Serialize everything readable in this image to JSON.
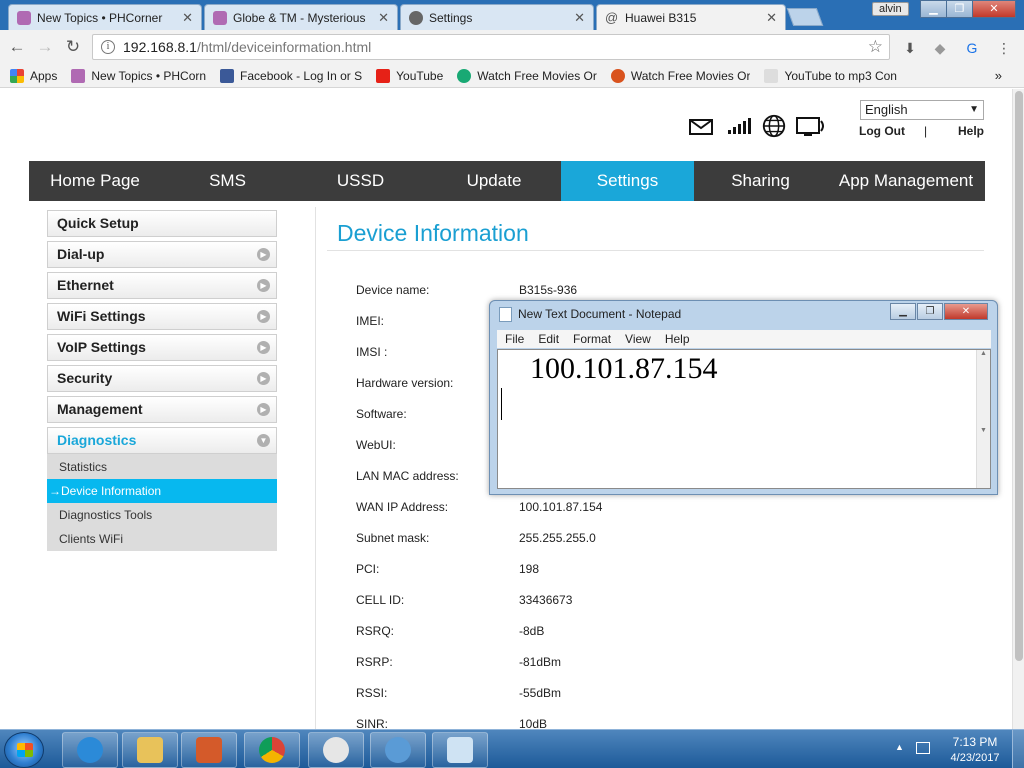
{
  "browser": {
    "tabs": [
      {
        "label": "New Topics • PHCorner",
        "active": false,
        "icon": "phcorner-favicon"
      },
      {
        "label": "Globe & TM - Mysterious",
        "active": false,
        "icon": "phcorner-favicon"
      },
      {
        "label": "Settings",
        "active": false,
        "icon": "gear-icon"
      },
      {
        "label": "Huawei B315",
        "active": true,
        "icon": "at-sign-icon"
      }
    ],
    "tab_close_glyph": "✕",
    "user": "alvin",
    "url_host": "192.168.8.1",
    "url_path": "/html/deviceinformation.html",
    "bookmarks": [
      {
        "label": "Apps",
        "icon": "apps-grid-icon"
      },
      {
        "label": "New Topics • PHCorn",
        "icon": "phcorner-favicon"
      },
      {
        "label": "Facebook - Log In or S",
        "icon": "facebook-icon"
      },
      {
        "label": "YouTube",
        "icon": "youtube-icon"
      },
      {
        "label": "Watch Free Movies Or",
        "icon": "play-icon"
      },
      {
        "label": "Watch Free Movies Or",
        "icon": "movie-icon"
      },
      {
        "label": "YouTube to mp3 Con",
        "icon": "yt-mp3-icon"
      }
    ],
    "bookmarks_more": "»"
  },
  "router": {
    "language": "English",
    "logout": "Log Out",
    "separator": "|",
    "help": "Help",
    "nav": [
      {
        "label": "Home Page",
        "active": false
      },
      {
        "label": "SMS",
        "active": false
      },
      {
        "label": "USSD",
        "active": false
      },
      {
        "label": "Update",
        "active": false
      },
      {
        "label": "Settings",
        "active": true
      },
      {
        "label": "Sharing",
        "active": false
      },
      {
        "label": "App Management",
        "active": false
      }
    ],
    "side_menu": [
      {
        "label": "Quick Setup",
        "expandable": false
      },
      {
        "label": "Dial-up",
        "expandable": true
      },
      {
        "label": "Ethernet",
        "expandable": true
      },
      {
        "label": "WiFi Settings",
        "expandable": true
      },
      {
        "label": "VoIP Settings",
        "expandable": true
      },
      {
        "label": "Security",
        "expandable": true
      },
      {
        "label": "Management",
        "expandable": true
      }
    ],
    "diagnostics": {
      "label": "Diagnostics",
      "items": [
        {
          "label": "Statistics",
          "active": false
        },
        {
          "label": "→Device Information",
          "active": true
        },
        {
          "label": "Diagnostics Tools",
          "active": false
        },
        {
          "label": "Clients WiFi",
          "active": false
        }
      ]
    },
    "title": "Device Information",
    "rows": [
      {
        "label": "Device name:",
        "value": "B315s-936"
      },
      {
        "label": "IMEI:",
        "value": ""
      },
      {
        "label": "IMSI :",
        "value": ""
      },
      {
        "label": "Hardware version:",
        "value": ""
      },
      {
        "label": "Software:",
        "value": ""
      },
      {
        "label": "WebUI:",
        "value": ""
      },
      {
        "label": "LAN MAC address:",
        "value": ""
      },
      {
        "label": "WAN IP Address:",
        "value": "100.101.87.154"
      },
      {
        "label": "Subnet mask:",
        "value": "255.255.255.0"
      },
      {
        "label": "PCI:",
        "value": "198"
      },
      {
        "label": "CELL ID:",
        "value": "33436673"
      },
      {
        "label": "RSRQ:",
        "value": "-8dB"
      },
      {
        "label": "RSRP:",
        "value": "-81dBm"
      },
      {
        "label": "RSSI:",
        "value": "-55dBm"
      },
      {
        "label": "SINR:",
        "value": "10dB"
      }
    ]
  },
  "notepad": {
    "title": "New Text Document - Notepad",
    "menu": [
      "File",
      "Edit",
      "Format",
      "View",
      "Help"
    ],
    "text": "100.101.87.154"
  },
  "taskbar": {
    "time": "7:13 PM",
    "date": "4/23/2017",
    "apps": [
      "internet-explorer-icon",
      "file-explorer-icon",
      "media-player-icon",
      "chrome-icon",
      "clock-app-icon",
      "globe-app-icon",
      "notepad-icon"
    ]
  }
}
